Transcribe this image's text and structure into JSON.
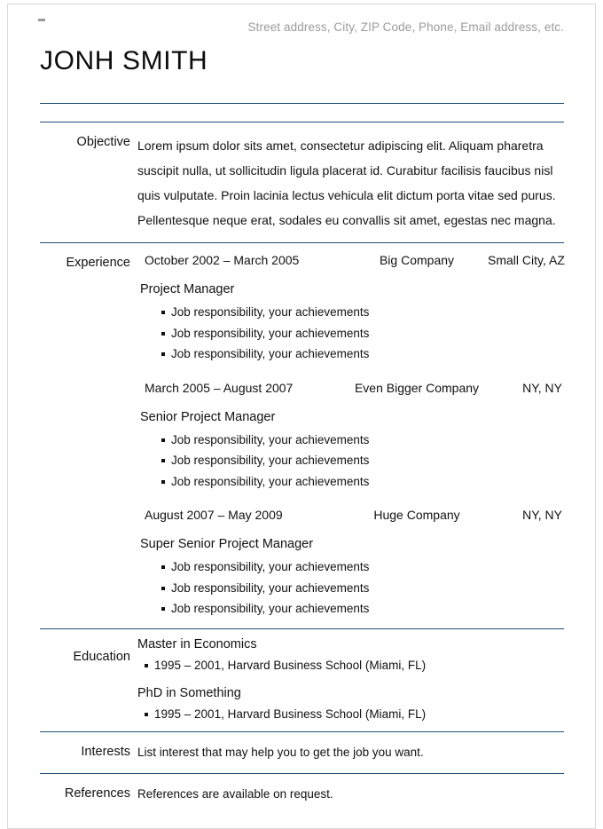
{
  "document": {
    "contact_line": "Street address, City, ZIP Code, Phone, Email address, etc.",
    "name": "JONH SMITH"
  },
  "objective": {
    "label": "Objective",
    "text": "Lorem ipsum dolor sits amet, consectetur adipiscing elit. Aliquam pharetra suscipit nulla, ut sollicitudin ligula placerat id. Curabitur facilisis faucibus nisl quis vulputate. Proin lacinia lectus vehicula elit dictum porta vitae sed purus. Pellentesque neque erat, sodales eu convallis sit amet, egestas nec magna."
  },
  "experience": {
    "label": "Experience",
    "jobs": [
      {
        "dates": "October 2002 – March 2005",
        "company": "Big Company",
        "location": "Small City, AZ",
        "title": "Project Manager",
        "bullets": [
          "Job responsibility, your achievements",
          "Job responsibility, your achievements",
          "Job responsibility, your achievements"
        ]
      },
      {
        "dates": "March 2005 – August 2007",
        "company": "Even Bigger Company",
        "location": "NY, NY",
        "title": "Senior Project Manager",
        "bullets": [
          "Job responsibility, your achievements",
          "Job responsibility, your achievements",
          "Job responsibility, your achievements"
        ]
      },
      {
        "dates": "August 2007 – May 2009",
        "company": "Huge Company",
        "location": "NY, NY",
        "title": "Super Senior Project Manager",
        "bullets": [
          "Job responsibility, your achievements",
          "Job responsibility, your achievements",
          "Job responsibility, your achievements"
        ]
      }
    ]
  },
  "education": {
    "label": "Education",
    "entries": [
      {
        "degree": "Master in Economics",
        "bullets": [
          "1995 – 2001, Harvard Business School (Miami, FL)"
        ]
      },
      {
        "degree": "PhD in Something",
        "bullets": [
          "1995 – 2001, Harvard Business School (Miami, FL)"
        ]
      }
    ]
  },
  "interests": {
    "label": "Interests",
    "text": "List interest that may help you to get the job you want."
  },
  "references": {
    "label": "References",
    "text": "References are available on request."
  },
  "colors": {
    "rule": "#1f4e79",
    "contact_text": "#9b9b9b",
    "body_text": "#111111",
    "page_border": "#d9d9d9"
  }
}
